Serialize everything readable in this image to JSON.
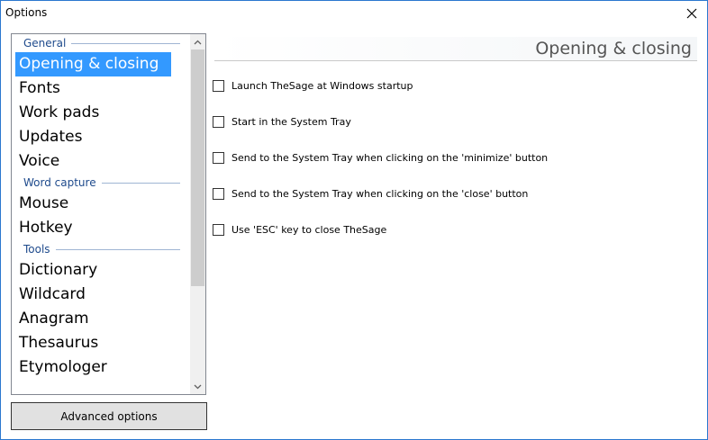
{
  "window": {
    "title": "Options"
  },
  "sidebar": {
    "groups": [
      {
        "label": "General",
        "items": [
          "Opening & closing",
          "Fonts",
          "Work pads",
          "Updates",
          "Voice"
        ]
      },
      {
        "label": "Word capture",
        "items": [
          "Mouse",
          "Hotkey"
        ]
      },
      {
        "label": "Tools",
        "items": [
          "Dictionary",
          "Wildcard",
          "Anagram",
          "Thesaurus",
          "Etymologer"
        ]
      }
    ],
    "selected": "Opening & closing"
  },
  "advanced_button": {
    "label": "Advanced options"
  },
  "main": {
    "title": "Opening & closing",
    "options": [
      {
        "label": "Launch TheSage at Windows startup",
        "checked": false
      },
      {
        "label": "Start in the System Tray",
        "checked": false
      },
      {
        "label": "Send to the System Tray when clicking on the 'minimize' button",
        "checked": false
      },
      {
        "label": "Send to the System Tray when clicking on the 'close' button",
        "checked": false
      },
      {
        "label": "Use 'ESC' key to close TheSage",
        "checked": false
      }
    ]
  },
  "icons": {
    "close": "close-icon",
    "scroll_up": "chevron-up-icon",
    "scroll_down": "chevron-down-icon"
  }
}
